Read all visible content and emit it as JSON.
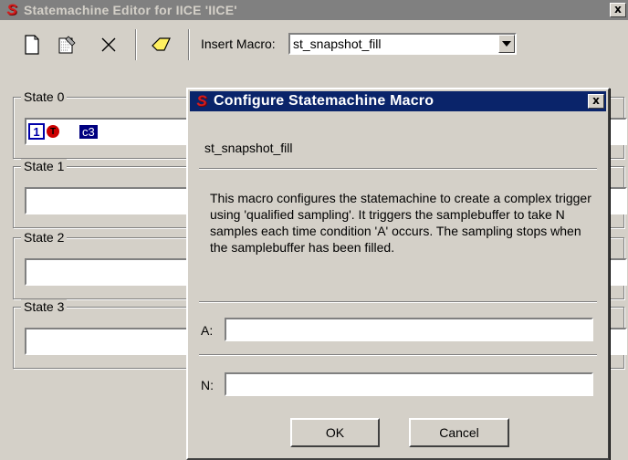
{
  "main_window": {
    "title": "Statemachine Editor for IICE 'IICE'",
    "logo": "S",
    "close": "x"
  },
  "toolbar": {
    "icons": [
      "new-document-icon",
      "edit-document-icon",
      "delete-icon",
      "eraser-icon"
    ],
    "insert_macro_label": "Insert Macro:",
    "macro_selected": "st_snapshot_fill"
  },
  "states": [
    {
      "label": "State 0",
      "badges": [
        "1",
        "T",
        "c3"
      ]
    },
    {
      "label": "State 1"
    },
    {
      "label": "State 2"
    },
    {
      "label": "State 3"
    }
  ],
  "dialog": {
    "title": "Configure Statemachine Macro",
    "logo": "S",
    "close": "x",
    "macro_name": "st_snapshot_fill",
    "description": "This macro configures the statemachine to create a complex trigger using 'qualified sampling'. It triggers the samplebuffer to take N samples each time condition 'A' occurs. The sampling stops when the samplebuffer has been filled.",
    "field_a_label": "A:",
    "field_a_value": "",
    "field_n_label": "N:",
    "field_n_value": "",
    "ok_label": "OK",
    "cancel_label": "Cancel"
  }
}
